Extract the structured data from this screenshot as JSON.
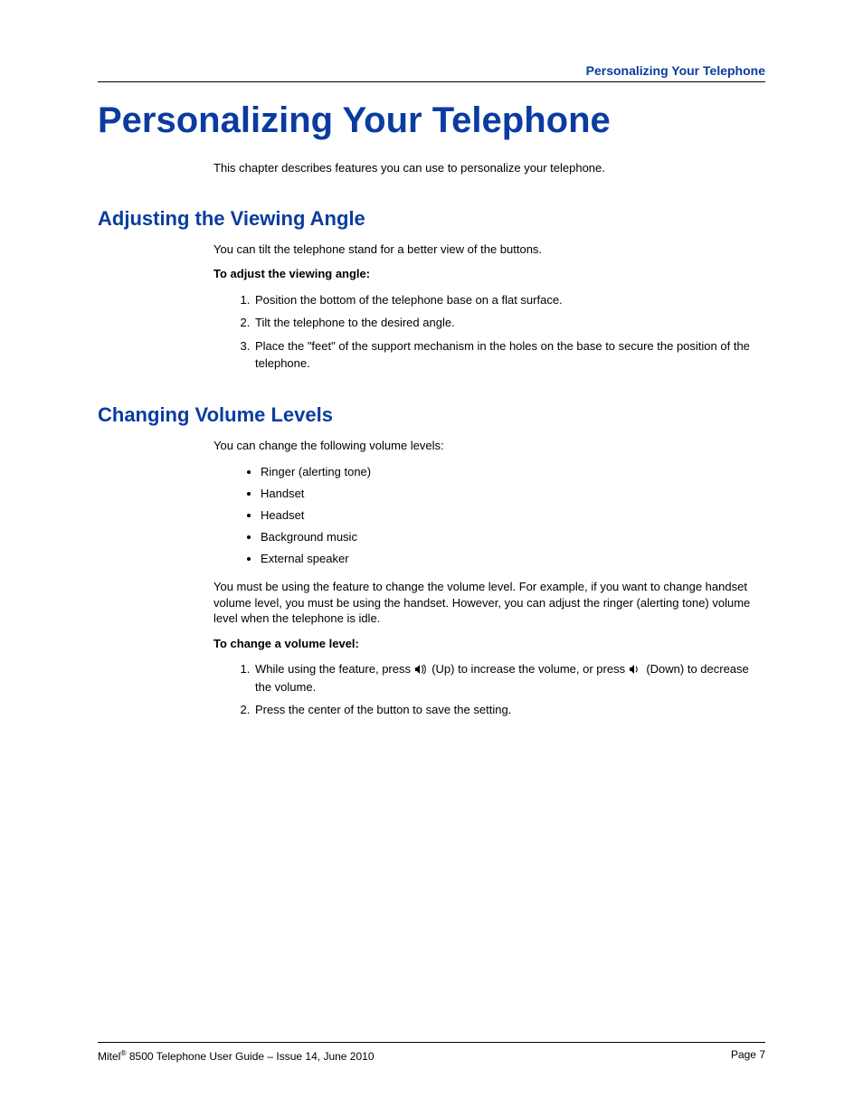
{
  "header": {
    "running_head": "Personalizing Your Telephone"
  },
  "chapter_title": "Personalizing Your Telephone",
  "intro": "This chapter describes features you can use to personalize your telephone.",
  "section1": {
    "title": "Adjusting the Viewing Angle",
    "lead": "You can tilt the telephone stand for a better view of the buttons.",
    "subhead": "To adjust the viewing angle:",
    "steps": [
      "Position the bottom of the telephone base on a flat surface.",
      "Tilt the telephone to the desired angle.",
      "Place the \"feet\" of the support mechanism in the holes on the base to secure the position of the telephone."
    ]
  },
  "section2": {
    "title": "Changing Volume Levels",
    "lead": "You can change the following volume levels:",
    "bullets": [
      "Ringer (alerting tone)",
      "Handset",
      "Headset",
      "Background music",
      "External speaker"
    ],
    "note": "You must be using the feature to change the volume level. For example, if you want to change handset volume level, you must be using the handset. However, you can adjust the ringer (alerting tone) volume level when the telephone is idle.",
    "subhead": "To change a volume level:",
    "steps": {
      "s1a": "While using the feature, press ",
      "s1b": " (Up) to increase the volume, or press ",
      "s1c": " (Down) to decrease the volume.",
      "s2": "Press the center of the button to save the setting."
    }
  },
  "footer": {
    "left_a": "Mitel",
    "left_b": " 8500 Telephone User Guide – Issue 14, June 2010",
    "right": "Page 7"
  }
}
